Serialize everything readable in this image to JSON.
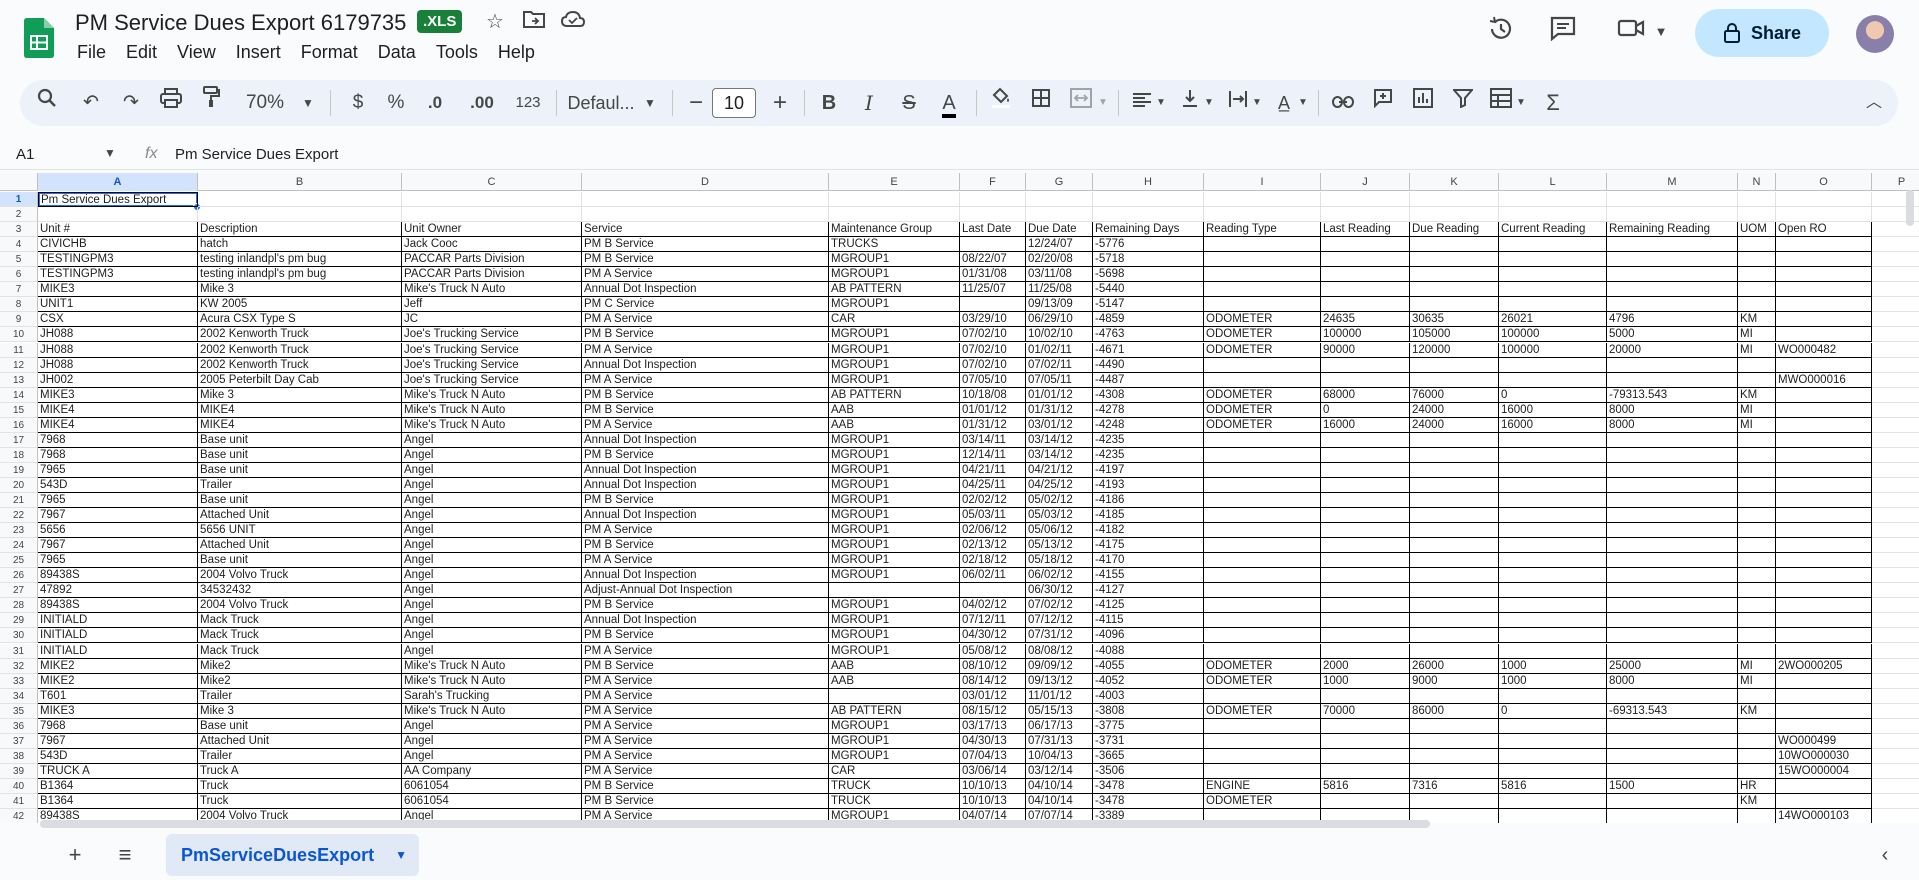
{
  "app": {
    "title": "PM Service Dues Export 6179735",
    "badge": ".XLS",
    "menu": [
      "File",
      "Edit",
      "View",
      "Insert",
      "Format",
      "Data",
      "Tools",
      "Help"
    ],
    "share_label": "Share"
  },
  "toolbar": {
    "zoom": "70%",
    "currency": "$",
    "percent": "%",
    "decrease_decimal": ".0",
    "increase_decimal": ".00",
    "number_format": "123",
    "font": "Defaul...",
    "font_size": "10"
  },
  "formula_bar": {
    "cell_ref": "A1",
    "content": "Pm Service Dues Export"
  },
  "columns": [
    "A",
    "B",
    "C",
    "D",
    "E",
    "F",
    "G",
    "H",
    "I",
    "J",
    "K",
    "L",
    "M",
    "N",
    "O",
    "P"
  ],
  "rows": [
    {
      "n": "1",
      "cells": [
        "Pm Service Dues Export",
        "",
        "",
        "",
        "",
        "",
        "",
        "",
        "",
        "",
        "",
        "",
        "",
        "",
        ""
      ]
    },
    {
      "n": "2",
      "cells": [
        "",
        "",
        "",
        "",
        "",
        "",
        "",
        "",
        "",
        "",
        "",
        "",
        "",
        "",
        ""
      ]
    },
    {
      "n": "3",
      "cells": [
        "Unit #",
        "Description",
        "Unit Owner",
        "Service",
        "Maintenance Group",
        "Last Date",
        "Due Date",
        "Remaining Days",
        "Reading Type",
        "Last Reading",
        "Due Reading",
        "Current Reading",
        "Remaining Reading",
        "UOM",
        "Open RO"
      ]
    },
    {
      "n": "4",
      "cells": [
        "CIVICHB",
        "hatch",
        "Jack Cooc",
        "PM B Service",
        "TRUCKS",
        "",
        "12/24/07",
        "-5776",
        "",
        "",
        "",
        "",
        "",
        "",
        ""
      ]
    },
    {
      "n": "5",
      "cells": [
        "TESTINGPM3",
        "testing inlandpl's pm bug",
        "PACCAR Parts Division",
        "PM B Service",
        "MGROUP1",
        "08/22/07",
        "02/20/08",
        "-5718",
        "",
        "",
        "",
        "",
        "",
        "",
        ""
      ]
    },
    {
      "n": "6",
      "cells": [
        "TESTINGPM3",
        "testing inlandpl's pm bug",
        "PACCAR Parts Division",
        "PM A Service",
        "MGROUP1",
        "01/31/08",
        "03/11/08",
        "-5698",
        "",
        "",
        "",
        "",
        "",
        "",
        ""
      ]
    },
    {
      "n": "7",
      "cells": [
        "MIKE3",
        "Mike 3",
        "Mike's Truck N Auto",
        "Annual Dot Inspection",
        "AB PATTERN",
        "11/25/07",
        "11/25/08",
        "-5440",
        "",
        "",
        "",
        "",
        "",
        "",
        ""
      ]
    },
    {
      "n": "8",
      "cells": [
        "UNIT1",
        "KW 2005",
        "Jeff",
        "PM C Service",
        "MGROUP1",
        "",
        "09/13/09",
        "-5147",
        "",
        "",
        "",
        "",
        "",
        "",
        ""
      ]
    },
    {
      "n": "9",
      "cells": [
        "CSX",
        "Acura CSX Type S",
        "JC",
        "PM A Service",
        "CAR",
        "03/29/10",
        "06/29/10",
        "-4859",
        "ODOMETER",
        "24635",
        "30635",
        "26021",
        "4796",
        "KM",
        ""
      ]
    },
    {
      "n": "10",
      "cells": [
        "JH088",
        "2002 Kenworth Truck",
        "Joe's Trucking Service",
        "PM B Service",
        "MGROUP1",
        "07/02/10",
        "10/02/10",
        "-4763",
        "ODOMETER",
        "100000",
        "105000",
        "100000",
        "5000",
        "MI",
        ""
      ]
    },
    {
      "n": "11",
      "cells": [
        "JH088",
        "2002 Kenworth Truck",
        "Joe's Trucking Service",
        "PM A Service",
        "MGROUP1",
        "07/02/10",
        "01/02/11",
        "-4671",
        "ODOMETER",
        "90000",
        "120000",
        "100000",
        "20000",
        "MI",
        "WO000482"
      ]
    },
    {
      "n": "12",
      "cells": [
        "JH088",
        "2002 Kenworth Truck",
        "Joe's Trucking Service",
        "Annual Dot Inspection",
        "MGROUP1",
        "07/02/10",
        "07/02/11",
        "-4490",
        "",
        "",
        "",
        "",
        "",
        "",
        ""
      ]
    },
    {
      "n": "13",
      "cells": [
        "JH002",
        "2005 Peterbilt Day Cab",
        "Joe's Trucking Service",
        "PM A Service",
        "MGROUP1",
        "07/05/10",
        "07/05/11",
        "-4487",
        "",
        "",
        "",
        "",
        "",
        "",
        "MWO000016"
      ]
    },
    {
      "n": "14",
      "cells": [
        "MIKE3",
        "Mike 3",
        "Mike's Truck N Auto",
        "PM B Service",
        "AB PATTERN",
        "10/18/08",
        "01/01/12",
        "-4308",
        "ODOMETER",
        "68000",
        "76000",
        "0",
        "-79313.543",
        "KM",
        ""
      ]
    },
    {
      "n": "15",
      "cells": [
        "MIKE4",
        "MIKE4",
        "Mike's Truck N Auto",
        "PM B Service",
        "AAB",
        "01/01/12",
        "01/31/12",
        "-4278",
        "ODOMETER",
        "0",
        "24000",
        "16000",
        "8000",
        "MI",
        ""
      ]
    },
    {
      "n": "16",
      "cells": [
        "MIKE4",
        "MIKE4",
        "Mike's Truck N Auto",
        "PM A Service",
        "AAB",
        "01/31/12",
        "03/01/12",
        "-4248",
        "ODOMETER",
        "16000",
        "24000",
        "16000",
        "8000",
        "MI",
        ""
      ]
    },
    {
      "n": "17",
      "cells": [
        "7968",
        "Base unit",
        "Angel",
        "Annual Dot Inspection",
        "MGROUP1",
        "03/14/11",
        "03/14/12",
        "-4235",
        "",
        "",
        "",
        "",
        "",
        "",
        ""
      ]
    },
    {
      "n": "18",
      "cells": [
        "7968",
        "Base unit",
        "Angel",
        "PM B Service",
        "MGROUP1",
        "12/14/11",
        "03/14/12",
        "-4235",
        "",
        "",
        "",
        "",
        "",
        "",
        ""
      ]
    },
    {
      "n": "19",
      "cells": [
        "7965",
        "Base unit",
        "Angel",
        "Annual Dot Inspection",
        "MGROUP1",
        "04/21/11",
        "04/21/12",
        "-4197",
        "",
        "",
        "",
        "",
        "",
        "",
        ""
      ]
    },
    {
      "n": "20",
      "cells": [
        "543D",
        "Trailer",
        "Angel",
        "Annual Dot Inspection",
        "MGROUP1",
        "04/25/11",
        "04/25/12",
        "-4193",
        "",
        "",
        "",
        "",
        "",
        "",
        ""
      ]
    },
    {
      "n": "21",
      "cells": [
        "7965",
        "Base unit",
        "Angel",
        "PM B Service",
        "MGROUP1",
        "02/02/12",
        "05/02/12",
        "-4186",
        "",
        "",
        "",
        "",
        "",
        "",
        ""
      ]
    },
    {
      "n": "22",
      "cells": [
        "7967",
        "Attached Unit",
        "Angel",
        "Annual Dot Inspection",
        "MGROUP1",
        "05/03/11",
        "05/03/12",
        "-4185",
        "",
        "",
        "",
        "",
        "",
        "",
        ""
      ]
    },
    {
      "n": "23",
      "cells": [
        "5656",
        "5656 UNIT",
        "Angel",
        "PM A Service",
        "MGROUP1",
        "02/06/12",
        "05/06/12",
        "-4182",
        "",
        "",
        "",
        "",
        "",
        "",
        ""
      ]
    },
    {
      "n": "24",
      "cells": [
        "7967",
        "Attached Unit",
        "Angel",
        "PM B Service",
        "MGROUP1",
        "02/13/12",
        "05/13/12",
        "-4175",
        "",
        "",
        "",
        "",
        "",
        "",
        ""
      ]
    },
    {
      "n": "25",
      "cells": [
        "7965",
        "Base unit",
        "Angel",
        "PM A Service",
        "MGROUP1",
        "02/18/12",
        "05/18/12",
        "-4170",
        "",
        "",
        "",
        "",
        "",
        "",
        ""
      ]
    },
    {
      "n": "26",
      "cells": [
        "89438S",
        "2004 Volvo Truck",
        "Angel",
        "Annual Dot Inspection",
        "MGROUP1",
        "06/02/11",
        "06/02/12",
        "-4155",
        "",
        "",
        "",
        "",
        "",
        "",
        ""
      ]
    },
    {
      "n": "27",
      "cells": [
        "47892",
        "34532432",
        "Angel",
        "Adjust-Annual Dot Inspection",
        "",
        "",
        "06/30/12",
        "-4127",
        "",
        "",
        "",
        "",
        "",
        "",
        ""
      ]
    },
    {
      "n": "28",
      "cells": [
        "89438S",
        "2004 Volvo Truck",
        "Angel",
        "PM B Service",
        "MGROUP1",
        "04/02/12",
        "07/02/12",
        "-4125",
        "",
        "",
        "",
        "",
        "",
        "",
        ""
      ]
    },
    {
      "n": "29",
      "cells": [
        "INITIALD",
        "Mack Truck",
        "Angel",
        "Annual Dot Inspection",
        "MGROUP1",
        "07/12/11",
        "07/12/12",
        "-4115",
        "",
        "",
        "",
        "",
        "",
        "",
        ""
      ]
    },
    {
      "n": "30",
      "cells": [
        "INITIALD",
        "Mack Truck",
        "Angel",
        "PM B Service",
        "MGROUP1",
        "04/30/12",
        "07/31/12",
        "-4096",
        "",
        "",
        "",
        "",
        "",
        "",
        ""
      ]
    },
    {
      "n": "31",
      "cells": [
        "INITIALD",
        "Mack Truck",
        "Angel",
        "PM A Service",
        "MGROUP1",
        "05/08/12",
        "08/08/12",
        "-4088",
        "",
        "",
        "",
        "",
        "",
        "",
        ""
      ]
    },
    {
      "n": "32",
      "cells": [
        "MIKE2",
        "Mike2",
        "Mike's Truck N Auto",
        "PM B Service",
        "AAB",
        "08/10/12",
        "09/09/12",
        "-4055",
        "ODOMETER",
        "2000",
        "26000",
        "1000",
        "25000",
        "MI",
        "2WO000205"
      ]
    },
    {
      "n": "33",
      "cells": [
        "MIKE2",
        "Mike2",
        "Mike's Truck N Auto",
        "PM A Service",
        "AAB",
        "08/14/12",
        "09/13/12",
        "-4052",
        "ODOMETER",
        "1000",
        "9000",
        "1000",
        "8000",
        "MI",
        ""
      ]
    },
    {
      "n": "34",
      "cells": [
        "T601",
        "Trailer",
        "Sarah's Trucking",
        "PM A Service",
        "",
        "03/01/12",
        "11/01/12",
        "-4003",
        "",
        "",
        "",
        "",
        "",
        "",
        ""
      ]
    },
    {
      "n": "35",
      "cells": [
        "MIKE3",
        "Mike 3",
        "Mike's Truck N Auto",
        "PM A Service",
        "AB PATTERN",
        "08/15/12",
        "05/15/13",
        "-3808",
        "ODOMETER",
        "70000",
        "86000",
        "0",
        "-69313.543",
        "KM",
        ""
      ]
    },
    {
      "n": "36",
      "cells": [
        "7968",
        "Base unit",
        "Angel",
        "PM A Service",
        "MGROUP1",
        "03/17/13",
        "06/17/13",
        "-3775",
        "",
        "",
        "",
        "",
        "",
        "",
        ""
      ]
    },
    {
      "n": "37",
      "cells": [
        "7967",
        "Attached Unit",
        "Angel",
        "PM A Service",
        "MGROUP1",
        "04/30/13",
        "07/31/13",
        "-3731",
        "",
        "",
        "",
        "",
        "",
        "",
        "WO000499"
      ]
    },
    {
      "n": "38",
      "cells": [
        "543D",
        "Trailer",
        "Angel",
        "PM A Service",
        "MGROUP1",
        "07/04/13",
        "10/04/13",
        "-3665",
        "",
        "",
        "",
        "",
        "",
        "",
        "10WO000030"
      ]
    },
    {
      "n": "39",
      "cells": [
        "TRUCK A",
        "Truck A",
        "AA Company",
        "PM A Service",
        "CAR",
        "03/06/14",
        "03/12/14",
        "-3506",
        "",
        "",
        "",
        "",
        "",
        "",
        "15WO000004"
      ]
    },
    {
      "n": "40",
      "cells": [
        "B1364",
        "Truck",
        "6061054",
        "PM B Service",
        "TRUCK",
        "10/10/13",
        "04/10/14",
        "-3478",
        "ENGINE",
        "5816",
        "7316",
        "5816",
        "1500",
        "HR",
        ""
      ]
    },
    {
      "n": "41",
      "cells": [
        "B1364",
        "Truck",
        "6061054",
        "PM B Service",
        "TRUCK",
        "10/10/13",
        "04/10/14",
        "-3478",
        "ODOMETER",
        "",
        "",
        "",
        "",
        "KM",
        ""
      ]
    },
    {
      "n": "42",
      "cells": [
        "89438S",
        "2004 Volvo Truck",
        "Angel",
        "PM A Service",
        "MGROUP1",
        "04/07/14",
        "07/07/14",
        "-3389",
        "",
        "",
        "",
        "",
        "",
        "",
        "14WO000103"
      ]
    }
  ],
  "sheet_tab": "PmServiceDuesExport"
}
